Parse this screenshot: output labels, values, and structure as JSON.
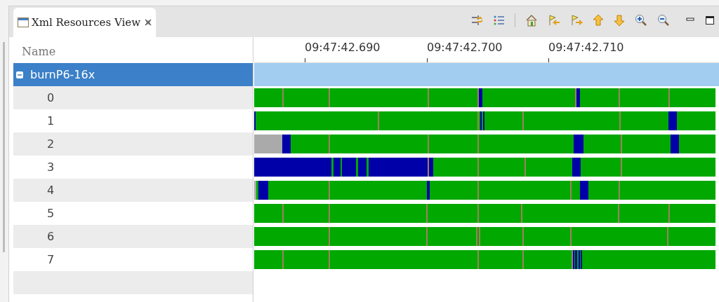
{
  "tab": {
    "title": "Xml Resources View",
    "selected": true
  },
  "columns": {
    "name_header": "Name",
    "time_ticks": [
      "09:47:42.690",
      "09:47:42.700",
      "09:47:42.710"
    ]
  },
  "tree": {
    "label": "burnP6-16x",
    "expanded": true,
    "selected": true,
    "children": [
      {
        "label": "0",
        "selected": false
      },
      {
        "label": "1",
        "selected": false
      },
      {
        "label": "2",
        "selected": false
      },
      {
        "label": "3",
        "selected": false
      },
      {
        "label": "4",
        "selected": false
      },
      {
        "label": "5",
        "selected": false
      },
      {
        "label": "6",
        "selected": false
      },
      {
        "label": "7",
        "selected": false
      }
    ]
  }
}
